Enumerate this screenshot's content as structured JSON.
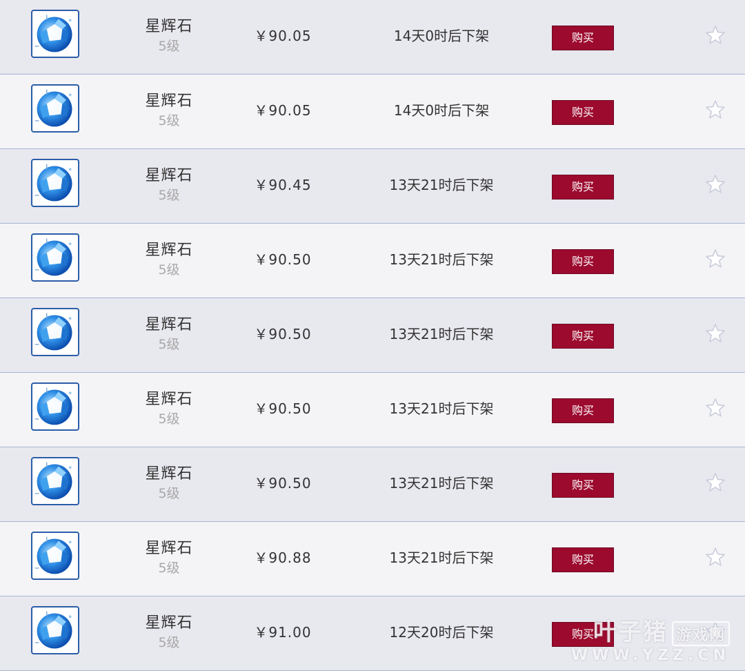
{
  "colors": {
    "buy_button": "#9c0a2e",
    "row_odd": "#e8e8ef",
    "row_even": "#f4f4f7",
    "divider": "#a9b4d3"
  },
  "listings": [
    {
      "name": "星辉石",
      "level": "5级",
      "price": "￥90.05",
      "expires": "14天0时后下架",
      "buy_label": "购买",
      "icon": "star-glow-stone-gem-icon"
    },
    {
      "name": "星辉石",
      "level": "5级",
      "price": "￥90.05",
      "expires": "14天0时后下架",
      "buy_label": "购买",
      "icon": "star-glow-stone-gem-icon"
    },
    {
      "name": "星辉石",
      "level": "5级",
      "price": "￥90.45",
      "expires": "13天21时后下架",
      "buy_label": "购买",
      "icon": "star-glow-stone-gem-icon"
    },
    {
      "name": "星辉石",
      "level": "5级",
      "price": "￥90.50",
      "expires": "13天21时后下架",
      "buy_label": "购买",
      "icon": "star-glow-stone-gem-icon"
    },
    {
      "name": "星辉石",
      "level": "5级",
      "price": "￥90.50",
      "expires": "13天21时后下架",
      "buy_label": "购买",
      "icon": "star-glow-stone-gem-icon"
    },
    {
      "name": "星辉石",
      "level": "5级",
      "price": "￥90.50",
      "expires": "13天21时后下架",
      "buy_label": "购买",
      "icon": "star-glow-stone-gem-icon"
    },
    {
      "name": "星辉石",
      "level": "5级",
      "price": "￥90.50",
      "expires": "13天21时后下架",
      "buy_label": "购买",
      "icon": "star-glow-stone-gem-icon"
    },
    {
      "name": "星辉石",
      "level": "5级",
      "price": "￥90.88",
      "expires": "13天21时后下架",
      "buy_label": "购买",
      "icon": "star-glow-stone-gem-icon"
    },
    {
      "name": "星辉石",
      "level": "5级",
      "price": "￥91.00",
      "expires": "12天20时后下架",
      "buy_label": "购买",
      "icon": "star-glow-stone-gem-icon"
    }
  ],
  "watermark": {
    "brand": "叶子猪",
    "tag": "游戏网",
    "url": "WWW.YZZ.CN"
  }
}
